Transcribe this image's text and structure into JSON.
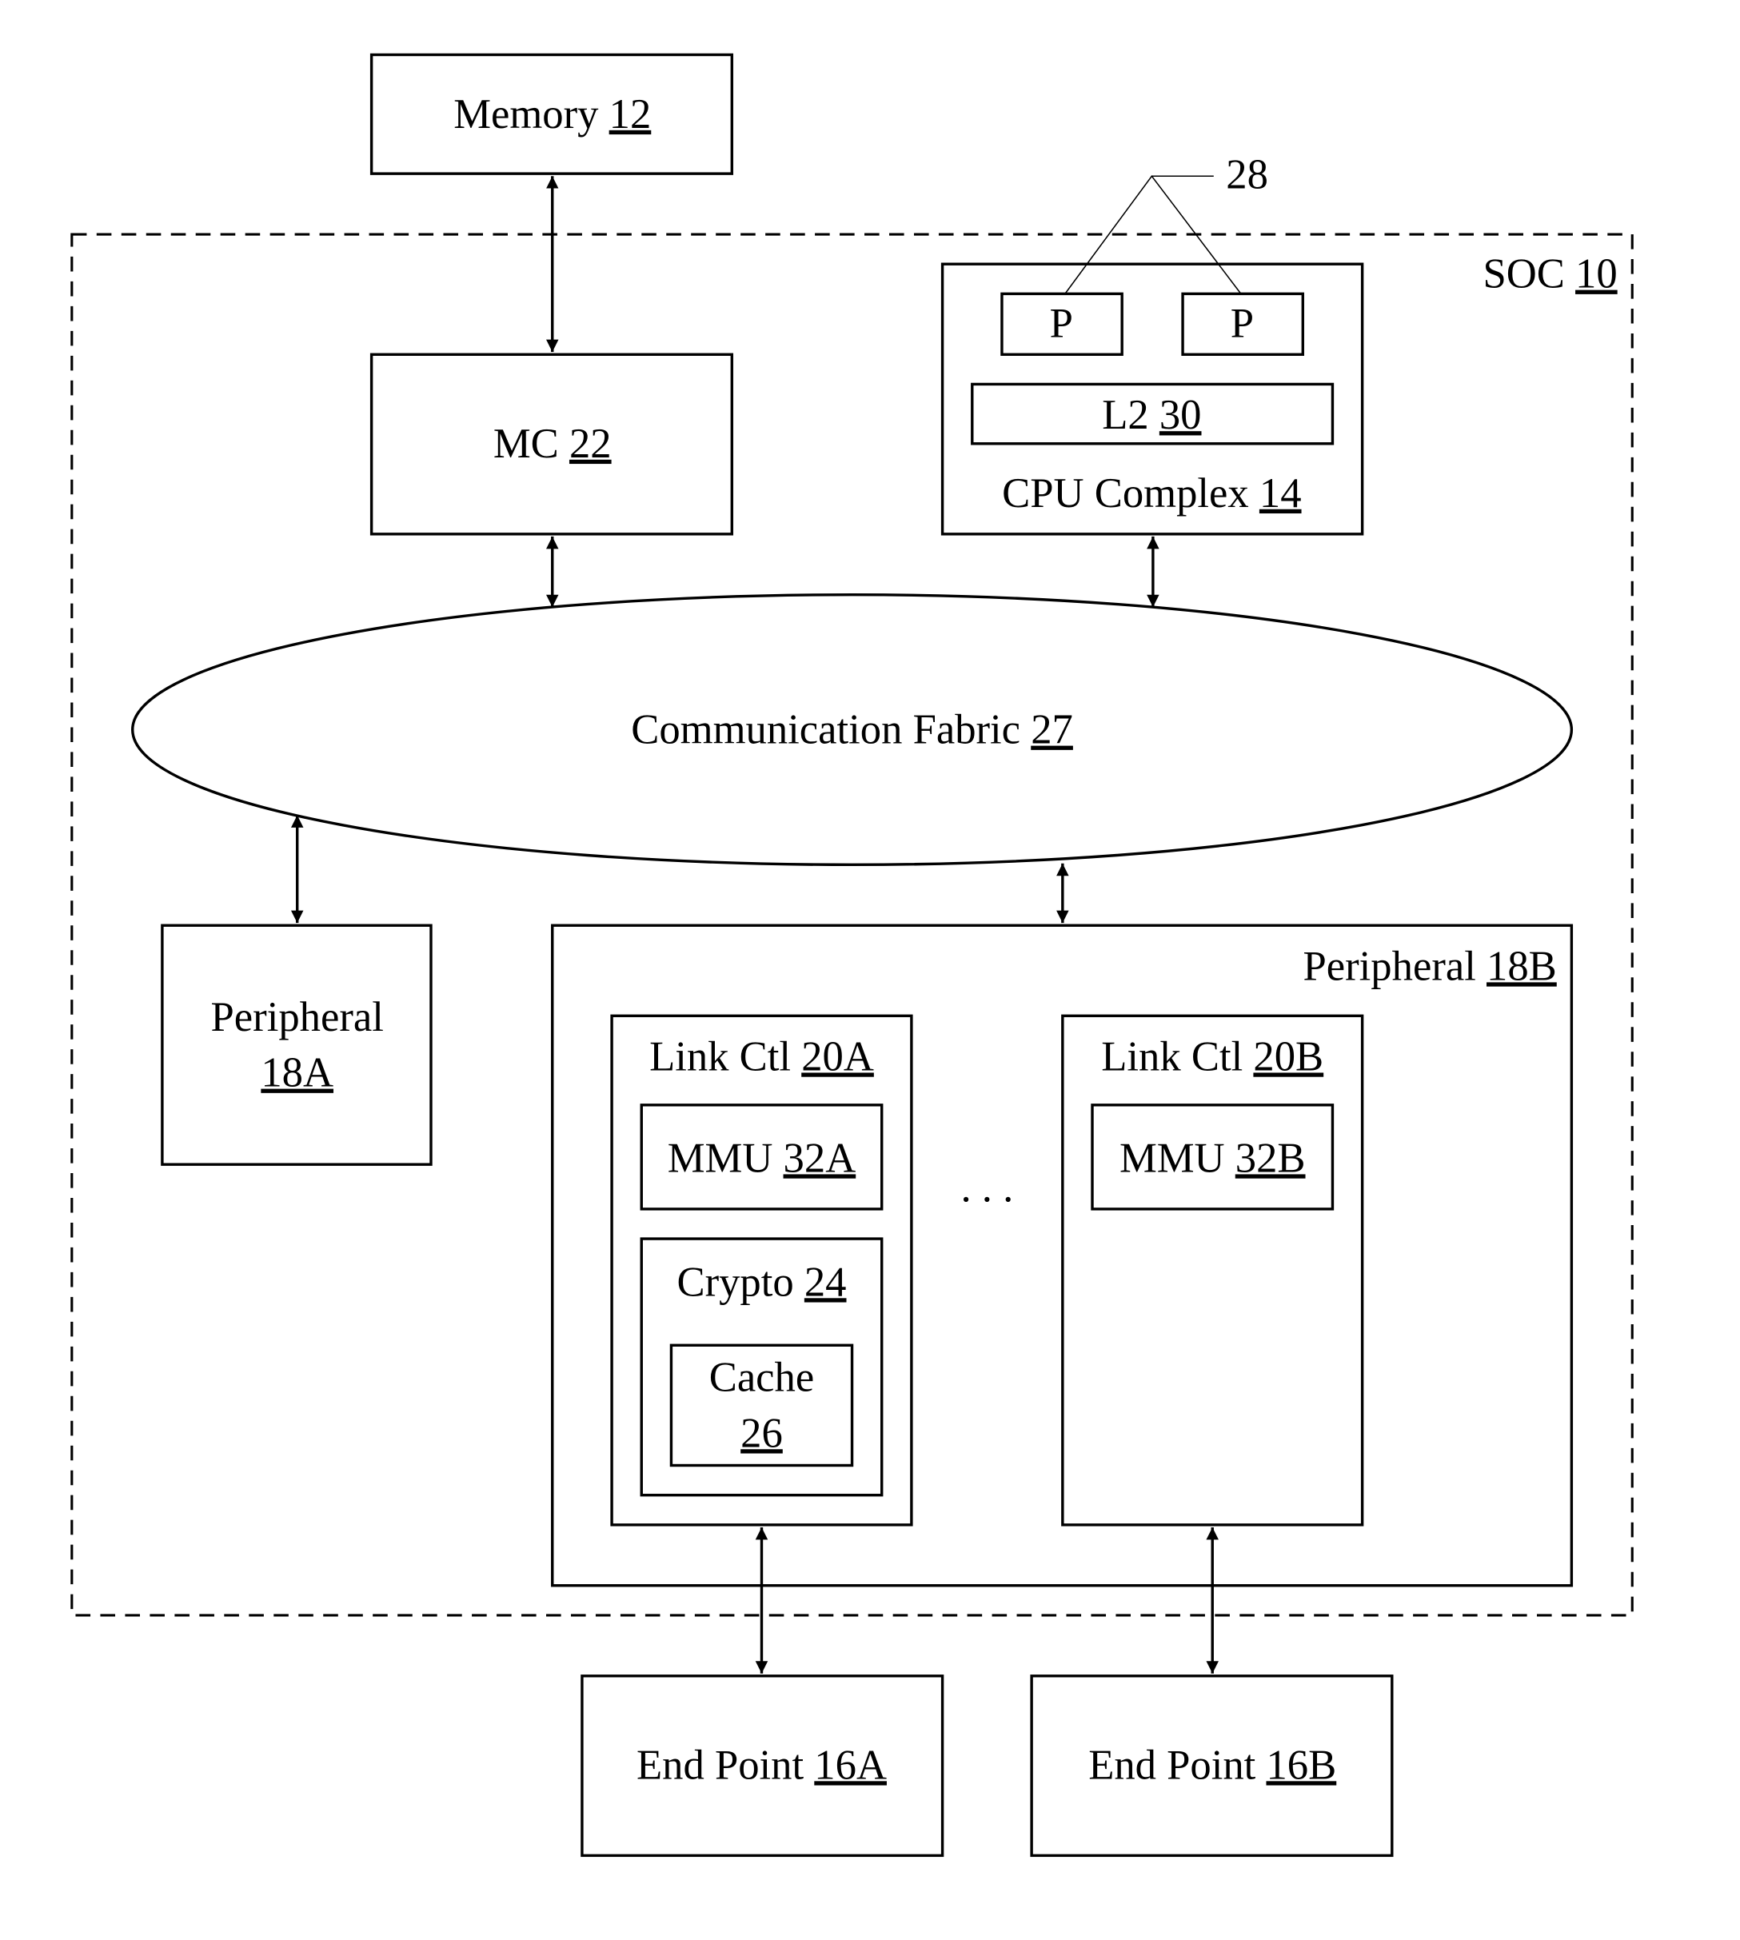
{
  "diagram": {
    "soc": {
      "name": "SOC",
      "ref": "10"
    },
    "memory": {
      "name": "Memory",
      "ref": "12"
    },
    "mc": {
      "name": "MC",
      "ref": "22"
    },
    "cpu_complex": {
      "name": "CPU Complex",
      "ref": "14"
    },
    "processors": [
      {
        "name": "P"
      },
      {
        "name": "P"
      }
    ],
    "processor_ref": "28",
    "l2": {
      "name": "L2",
      "ref": "30"
    },
    "fabric": {
      "name": "Communication Fabric",
      "ref": "27"
    },
    "peripheral_a": {
      "name": "Peripheral",
      "ref": "18A"
    },
    "peripheral_b": {
      "name": "Peripheral",
      "ref": "18B"
    },
    "link_ctl_a": {
      "name": "Link Ctl",
      "ref": "20A"
    },
    "link_ctl_b": {
      "name": "Link Ctl",
      "ref": "20B"
    },
    "mmu_a": {
      "name": "MMU",
      "ref": "32A"
    },
    "mmu_b": {
      "name": "MMU",
      "ref": "32B"
    },
    "crypto": {
      "name": "Crypto",
      "ref": "24"
    },
    "cache": {
      "name": "Cache",
      "ref": "26"
    },
    "ellipsis": ". . .",
    "endpoint_a": {
      "name": "End Point",
      "ref": "16A"
    },
    "endpoint_b": {
      "name": "End Point",
      "ref": "16B"
    }
  }
}
